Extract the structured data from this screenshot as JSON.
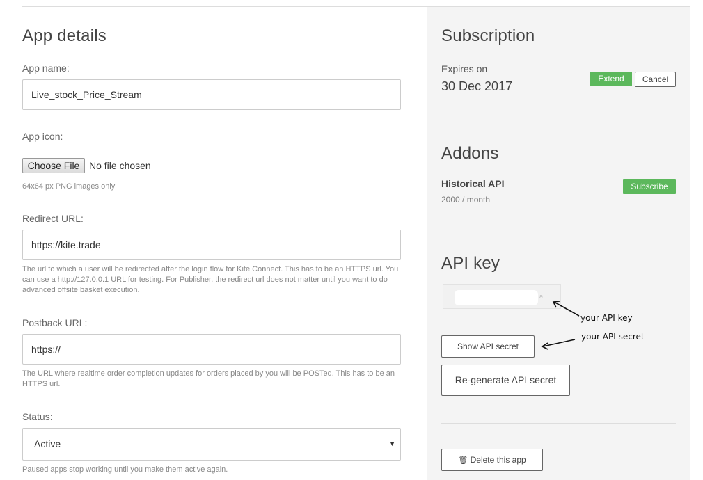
{
  "app_details": {
    "title": "App details",
    "app_name": {
      "label": "App name:",
      "value": "Live_stock_Price_Stream"
    },
    "app_icon": {
      "label": "App icon:",
      "button": "Choose File",
      "status": "No file chosen",
      "help": "64x64 px PNG images only"
    },
    "redirect_url": {
      "label": "Redirect URL:",
      "value": "https://kite.trade",
      "help": "The url to which a user will be redirected after the login flow for Kite Connect. This has to be an HTTPS url. You can use a http://127.0.0.1 URL for testing. For Publisher, the redirect url does not matter until you want to do advanced offsite basket execution."
    },
    "postback_url": {
      "label": "Postback URL:",
      "value": "https://",
      "help": "The URL where realtime order completion updates for orders placed by you will be POSTed. This has to be an HTTPS url."
    },
    "status": {
      "label": "Status:",
      "selected": "Active",
      "help": "Paused apps stop working until you make them active again."
    }
  },
  "subscription": {
    "title": "Subscription",
    "expires_label": "Expires on",
    "expires_date": "30 Dec 2017",
    "extend_label": "Extend",
    "cancel_label": "Cancel"
  },
  "addons": {
    "title": "Addons",
    "name": "Historical API",
    "price": "2000 / month",
    "subscribe_label": "Subscribe"
  },
  "api_key": {
    "title": "API key",
    "key_fragment": "a",
    "show_secret_label": "Show API secret",
    "regenerate_label": "Re-generate API secret",
    "annotation_key": "your API key",
    "annotation_secret": "your API secret"
  },
  "delete": {
    "label": "Delete this app",
    "icon": "trash-icon"
  },
  "colors": {
    "green": "#5cb85c",
    "panel": "#f4f4f4"
  }
}
